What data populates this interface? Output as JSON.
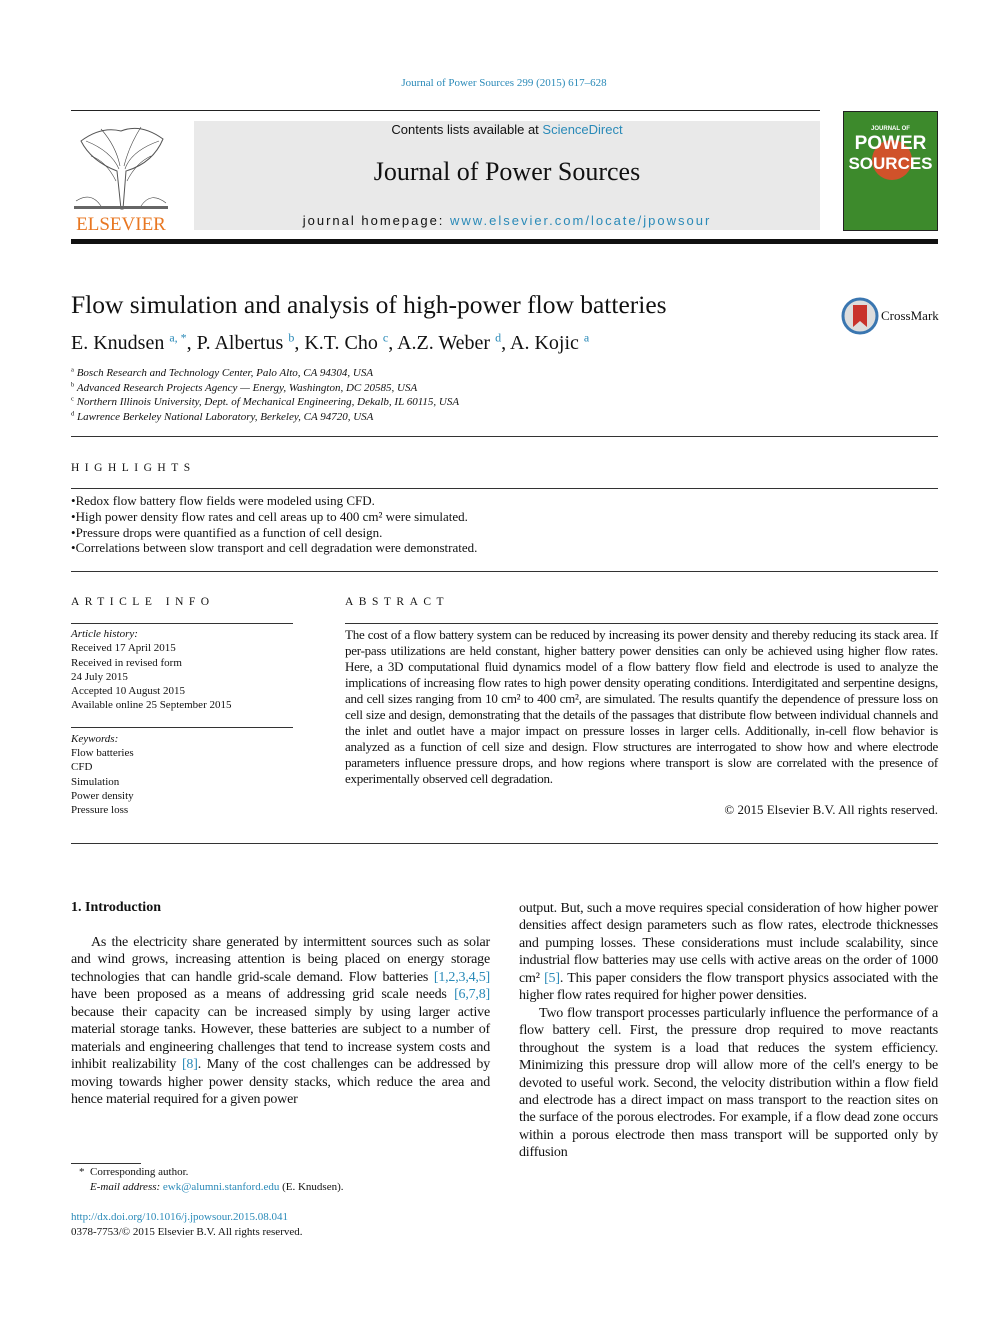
{
  "header": {
    "citation": "Journal of Power Sources 299 (2015) 617–628",
    "contents_prefix": "Contents lists available at ",
    "contents_link": "ScienceDirect",
    "journal_title": "Journal of Power Sources",
    "homepage_prefix": "journal homepage: ",
    "homepage_link": "www.elsevier.com/locate/jpowsour",
    "publisher": "ELSEVIER",
    "cover_text": [
      "JOURNAL OF",
      "POWER",
      "SOURCES"
    ],
    "crossmark": "CrossMark"
  },
  "article": {
    "title": "Flow simulation and analysis of high-power flow batteries",
    "authors": [
      {
        "name": "E. Knudsen",
        "sup": "a, *"
      },
      {
        "name": "P. Albertus",
        "sup": "b"
      },
      {
        "name": "K.T. Cho",
        "sup": "c"
      },
      {
        "name": "A.Z. Weber",
        "sup": "d"
      },
      {
        "name": "A. Kojic",
        "sup": "a"
      }
    ],
    "affiliations": [
      {
        "key": "a",
        "text": "Bosch Research and Technology Center, Palo Alto, CA 94304, USA"
      },
      {
        "key": "b",
        "text": "Advanced Research Projects Agency — Energy, Washington, DC 20585, USA"
      },
      {
        "key": "c",
        "text": "Northern Illinois University, Dept. of Mechanical Engineering, Dekalb, IL 60115, USA"
      },
      {
        "key": "d",
        "text": "Lawrence Berkeley National Laboratory, Berkeley, CA 94720, USA"
      }
    ]
  },
  "highlights": {
    "heading": "HIGHLIGHTS",
    "items": [
      "Redox flow battery flow fields were modeled using CFD.",
      "High power density flow rates and cell areas up to 400 cm² were simulated.",
      "Pressure drops were quantified as a function of cell design.",
      "Correlations between slow transport and cell degradation were demonstrated."
    ]
  },
  "article_info": {
    "heading": "ARTICLE INFO",
    "history_label": "Article history:",
    "history": [
      "Received 17 April 2015",
      "Received in revised form",
      "24 July 2015",
      "Accepted 10 August 2015",
      "Available online 25 September 2015"
    ],
    "keywords_label": "Keywords:",
    "keywords": [
      "Flow batteries",
      "CFD",
      "Simulation",
      "Power density",
      "Pressure loss"
    ]
  },
  "abstract": {
    "heading": "ABSTRACT",
    "text": "The cost of a flow battery system can be reduced by increasing its power density and thereby reducing its stack area. If per-pass utilizations are held constant, higher battery power densities can only be achieved using higher flow rates. Here, a 3D computational fluid dynamics model of a flow battery flow field and electrode is used to analyze the implications of increasing flow rates to high power density operating conditions. Interdigitated and serpentine designs, and cell sizes ranging from 10 cm² to 400 cm², are simulated. The results quantify the dependence of pressure loss on cell size and design, demonstrating that the details of the passages that distribute flow between individual channels and the inlet and outlet have a major impact on pressure losses in larger cells. Additionally, in-cell flow behavior is analyzed as a function of cell size and design. Flow structures are interrogated to show how and where electrode parameters influence pressure drops, and how regions where transport is slow are correlated with the presence of experimentally observed cell degradation.",
    "copyright": "© 2015 Elsevier B.V. All rights reserved."
  },
  "body": {
    "section_heading": "1.  Introduction",
    "col1": [
      [
        {
          "t": "As the electricity share generated by intermittent sources such as solar and wind grows, increasing attention is being placed on energy storage technologies that can handle grid-scale demand. Flow batteries "
        },
        {
          "t": "[1,2,3,4,5]",
          "link": true
        },
        {
          "t": " have been proposed as a means of addressing grid scale needs "
        },
        {
          "t": "[6,7,8]",
          "link": true
        },
        {
          "t": " because their capacity can be increased simply by using larger active material storage tanks. However, these batteries are subject to a number of materials and engineering challenges that tend to increase system costs and inhibit realizability "
        },
        {
          "t": "[8]",
          "link": true
        },
        {
          "t": ". Many of the cost challenges can be addressed by moving towards higher power density stacks, which reduce the area and hence material required for a given power"
        }
      ]
    ],
    "col2": [
      [
        {
          "t": "output. But, such a move requires special consideration of how higher power densities affect design parameters such as flow rates, electrode thicknesses and pumping losses. These considerations must include scalability, since industrial flow batteries may use cells with active areas on the order of 1000 cm² "
        },
        {
          "t": "[5]",
          "link": true
        },
        {
          "t": ". This paper considers the flow transport physics associated with the higher flow rates required for higher power densities."
        }
      ],
      [
        {
          "t": "Two flow transport processes particularly influence the performance of a flow battery cell. First, the pressure drop required to move reactants throughout the system is a load that reduces the system efficiency. Minimizing this pressure drop will allow more of the cell's energy to be devoted to useful work. Second, the velocity distribution within a flow field and electrode has a direct impact on mass transport to the reaction sites on the surface of the porous electrodes. For example, if a flow dead zone occurs within a porous electrode then mass transport will be supported only by diffusion"
        }
      ]
    ]
  },
  "footnote": {
    "marker": "*",
    "corresponding": "Corresponding author.",
    "email_label": "E-mail address: ",
    "email": "ewk@alumni.stanford.edu",
    "email_suffix": " (E. Knudsen).",
    "doi": "http://dx.doi.org/10.1016/j.jpowsour.2015.08.041",
    "issn": "0378-7753/© 2015 Elsevier B.V. All rights reserved."
  },
  "colors": {
    "link": "#2a8ab8",
    "cover": "#3d8a2c",
    "banner": "#e9e9e9"
  }
}
